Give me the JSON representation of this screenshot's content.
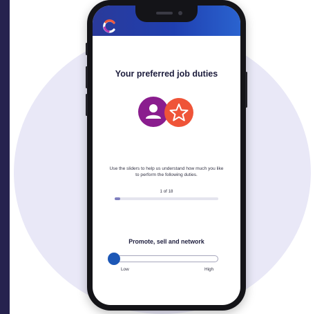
{
  "screen": {
    "title": "Your preferred job duties",
    "instructions": "Use the sliders to help us understand how much you like to perform the following duties.",
    "progress": {
      "counter": "1 of 18",
      "current": 1,
      "total": 18
    },
    "duty": {
      "label": "Promote, sell and network",
      "low_label": "Low",
      "high_label": "High",
      "slider_value": 0.0
    },
    "icons": [
      "person-icon",
      "star-icon",
      "app-logo-icon"
    ]
  },
  "colors": {
    "header_gradient_start": "#2a3a9a",
    "header_gradient_end": "#2a63cf",
    "purple_circle": "#8a1d8e",
    "orange_circle": "#ef5438",
    "slider_thumb": "#1c57b6",
    "background_circle": "#e9e8f7"
  }
}
